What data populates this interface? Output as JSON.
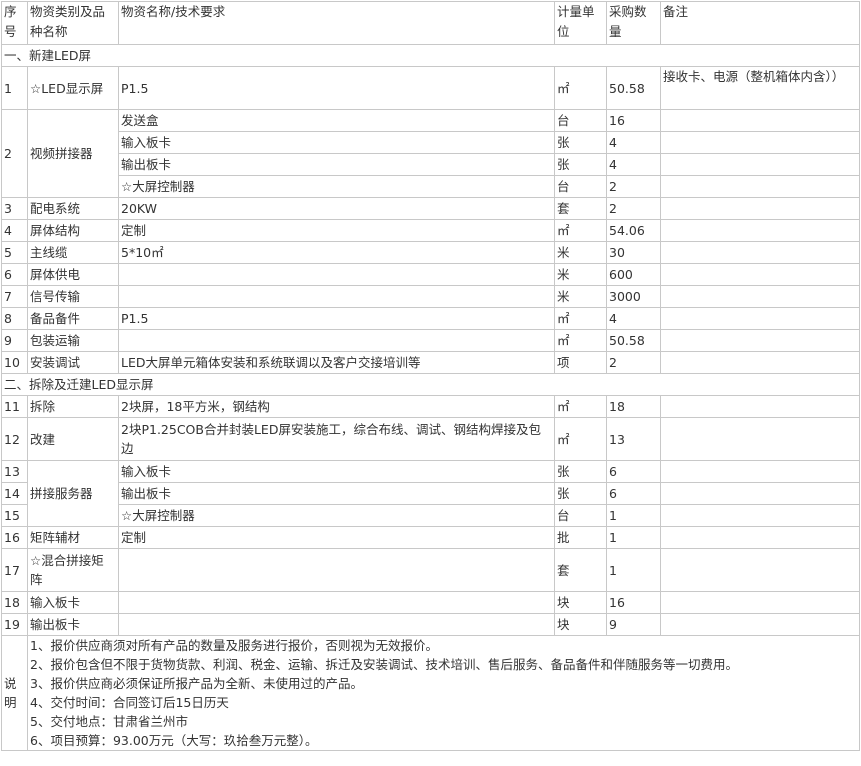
{
  "header": {
    "seq": "序号",
    "category": "物资类别及品种名称",
    "spec": "物资名称/技术要求",
    "unit": "计量单位",
    "qty": "采购数量",
    "remark": "备注"
  },
  "sections": {
    "s1": "一、新建LED屏",
    "s2": "二、拆除及迁建LED显示屏"
  },
  "rows": {
    "r1": {
      "seq": "1",
      "cat": "☆LED显示屏",
      "spec": "P1.5",
      "unit": "㎡",
      "qty": "50.58",
      "remark": "接收卡、电源（整机箱体内含））"
    },
    "r2": {
      "seq": "2",
      "cat": "视频拼接器"
    },
    "r2a": {
      "spec": "发送盒",
      "unit": "台",
      "qty": "16"
    },
    "r2b": {
      "spec": "输入板卡",
      "unit": "张",
      "qty": "4"
    },
    "r2c": {
      "spec": "输出板卡",
      "unit": "张",
      "qty": "4"
    },
    "r2d": {
      "spec": "☆大屏控制器",
      "unit": "台",
      "qty": "2"
    },
    "r3": {
      "seq": "3",
      "cat": "配电系统",
      "spec": "20KW",
      "unit": "套",
      "qty": "2"
    },
    "r4": {
      "seq": "4",
      "cat": "屏体结构",
      "spec": "定制",
      "unit": "㎡",
      "qty": "54.06"
    },
    "r5": {
      "seq": "5",
      "cat": "主线缆",
      "spec": "5*10㎡",
      "unit": "米",
      "qty": "30"
    },
    "r6": {
      "seq": "6",
      "cat": "屏体供电",
      "spec": "",
      "unit": "米",
      "qty": "600"
    },
    "r7": {
      "seq": "7",
      "cat": "信号传输",
      "spec": "",
      "unit": "米",
      "qty": "3000"
    },
    "r8": {
      "seq": "8",
      "cat": "备品备件",
      "spec": "P1.5",
      "unit": "㎡",
      "qty": "4"
    },
    "r9": {
      "seq": "9",
      "cat": "包装运输",
      "spec": "",
      "unit": "㎡",
      "qty": "50.58"
    },
    "r10": {
      "seq": "10",
      "cat": "安装调试",
      "spec": "LED大屏单元箱体安装和系统联调以及客户交接培训等",
      "unit": "项",
      "qty": "2"
    },
    "r11": {
      "seq": "11",
      "cat": "拆除",
      "spec": "2块屏，18平方米，钢结构",
      "unit": "㎡",
      "qty": "18"
    },
    "r12": {
      "seq": "12",
      "cat": "改建",
      "spec": "2块P1.25COB合并封装LED屏安装施工，综合布线、调试、钢结构焊接及包边",
      "unit": "㎡",
      "qty": "13"
    },
    "r13": {
      "seq": "13",
      "spec": "输入板卡",
      "unit": "张",
      "qty": "6"
    },
    "r14": {
      "seq": "14",
      "cat": "拼接服务器",
      "spec": "输出板卡",
      "unit": "张",
      "qty": "6"
    },
    "r15": {
      "seq": "15",
      "spec": "☆大屏控制器",
      "unit": "台",
      "qty": "1"
    },
    "r16": {
      "seq": "16",
      "cat": "矩阵辅材",
      "spec": "定制",
      "unit": "批",
      "qty": "1"
    },
    "r17": {
      "seq": "17",
      "cat": "☆混合拼接矩阵",
      "spec": "",
      "unit": "套",
      "qty": "1"
    },
    "r18": {
      "seq": "18",
      "cat": "输入板卡",
      "spec": "",
      "unit": "块",
      "qty": "16"
    },
    "r19": {
      "seq": "19",
      "cat": "输出板卡",
      "spec": "",
      "unit": "块",
      "qty": "9"
    }
  },
  "notes": {
    "label": "说明",
    "n1": "1、报价供应商须对所有产品的数量及服务进行报价，否则视为无效报价。",
    "n2": "2、报价包含但不限于货物货款、利润、税金、运输、拆迁及安装调试、技术培训、售后服务、备品备件和伴随服务等一切费用。",
    "n3": "3、报价供应商必须保证所报产品为全新、未使用过的产品。",
    "n4": "4、交付时间：合同签订后15日历天",
    "n5": "5、交付地点：甘肃省兰州市",
    "n6": "6、项目预算：93.00万元（大写：玖拾叁万元整）。"
  }
}
